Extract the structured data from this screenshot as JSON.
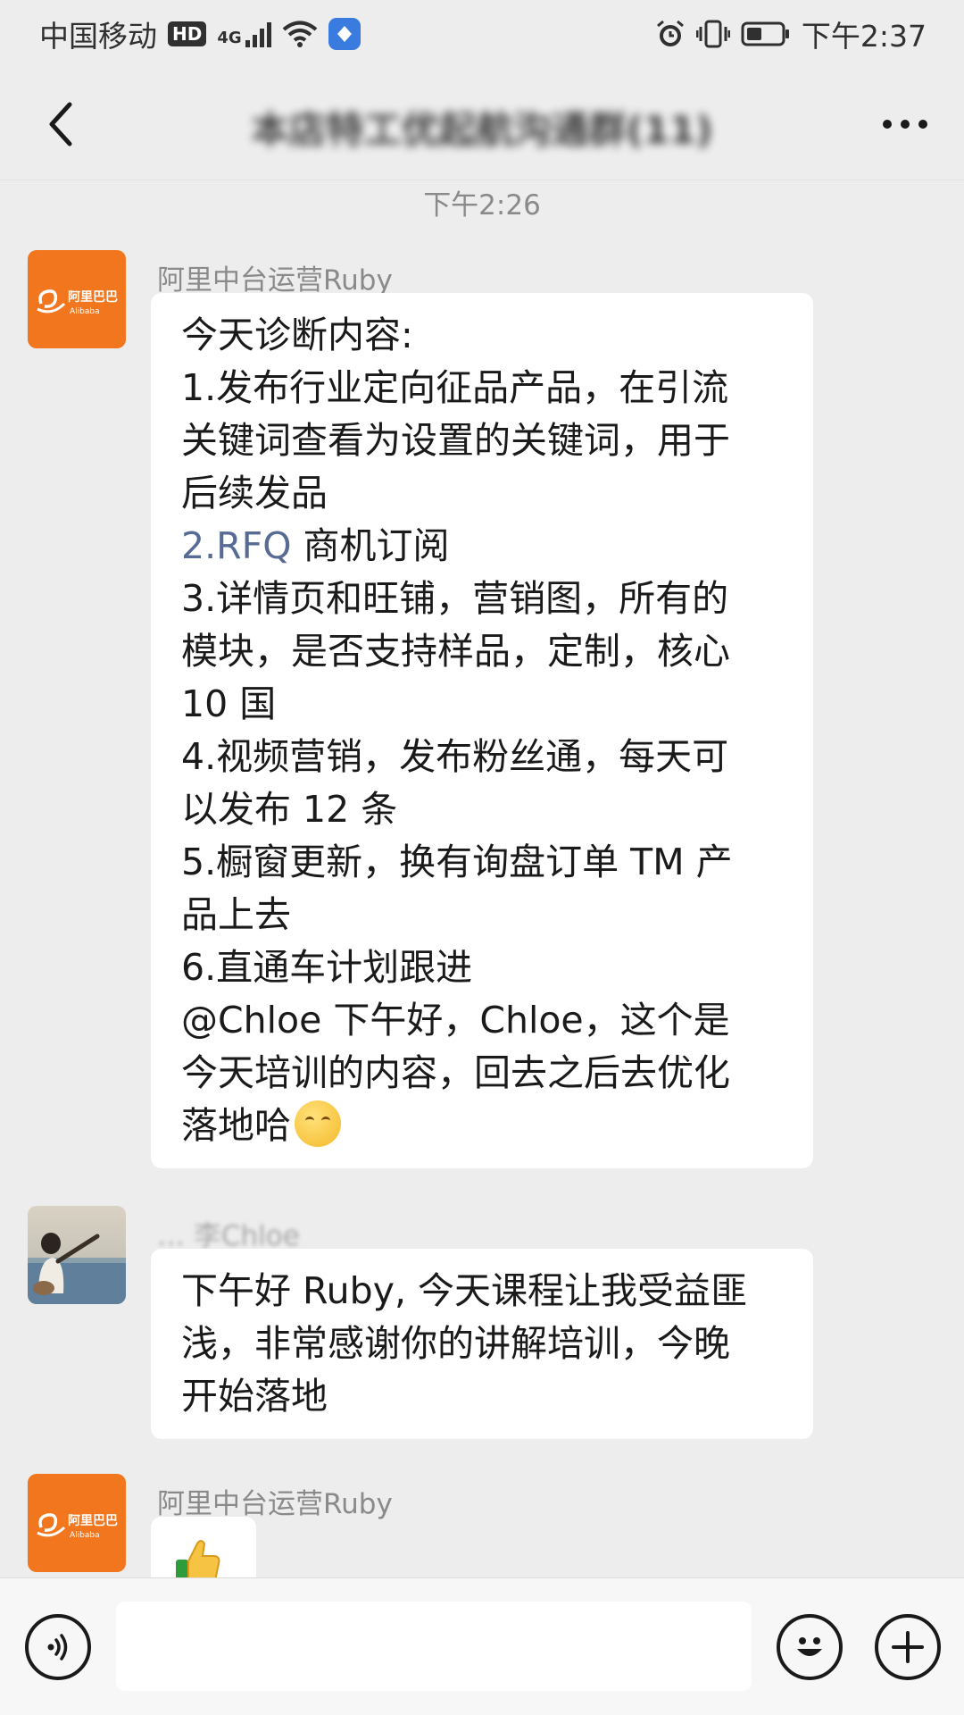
{
  "status_bar": {
    "carrier": "中国移动",
    "hd_badge": "HD",
    "network_type": "4G",
    "time": "下午2:37"
  },
  "header": {
    "title": "本店特工优起航沟通群(11)",
    "title_member_count": "(11)",
    "back_icon": "chevron-left-icon",
    "more_icon": "more-dots-icon"
  },
  "chat": {
    "timestamp": "下午2:26",
    "messages": [
      {
        "sender": "阿里中台运营Ruby",
        "avatar_brand": "阿里巴巴",
        "avatar_brand_en": "Alibaba",
        "lines": [
          "今天诊断内容:",
          "1.发布行业定向征品产品，在引流",
          "关键词查看为设置的关键词，用于",
          "后续发品",
          "2.RFQ 商机订阅",
          "3.详情页和旺铺，营销图，所有的",
          "模块，是否支持样品，定制，核心",
          "10 国",
          "4.视频营销，发布粉丝通，每天可",
          "以发布 12 条",
          "5.橱窗更新，换有询盘订单 TM 产",
          "品上去",
          "6.直通车计划跟进",
          "@Chloe  下午好，Chloe，这个是",
          "今天培训的内容，回去之后去优化",
          "落地哈"
        ],
        "link_text": "2.RFQ",
        "link_rest": " 商机订阅",
        "emoji": "smile-emoji-icon"
      },
      {
        "sender": "… 李Chloe",
        "lines": [
          "下午好 Ruby, 今天课程让我受益匪",
          "浅，非常感谢你的讲解培训，今晚",
          "开始落地"
        ]
      },
      {
        "sender": "阿里中台运营Ruby",
        "avatar_brand": "阿里巴巴",
        "avatar_brand_en": "Alibaba",
        "emoji": "thumbs-up-emoji-icon"
      }
    ]
  },
  "input_bar": {
    "voice_icon": "voice-icon",
    "emoji_icon": "emoji-face-icon",
    "plus_icon": "plus-icon",
    "placeholder": ""
  },
  "colors": {
    "background": "#ededed",
    "bubble": "#ffffff",
    "link": "#576b95",
    "alibaba_orange": "#f2761d"
  }
}
